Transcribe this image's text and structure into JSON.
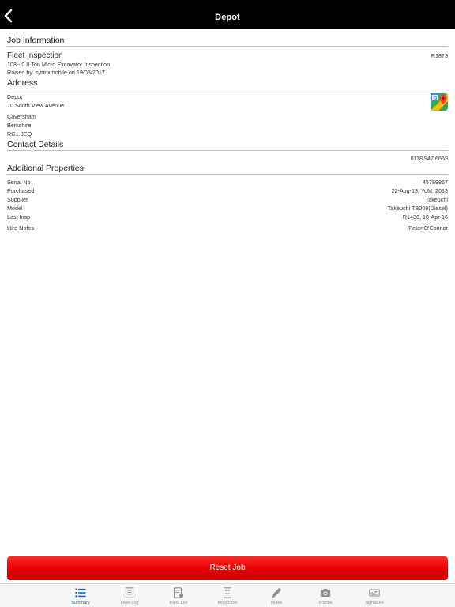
{
  "nav": {
    "title": "Depot"
  },
  "job_info": {
    "heading": "Job Information",
    "title": "Fleet Inspection",
    "ref": "R1873",
    "description": "108 - 0.8 Ton Micro Excavator Inspection",
    "raised_by": "Raised by: syrinxmobile on 19/05/2017"
  },
  "address": {
    "heading": "Address",
    "lines": [
      "Depot",
      "70 South View Avenue",
      "Caversham",
      "Berkshire",
      "RG1 8EQ"
    ]
  },
  "contact": {
    "heading": "Contact Details",
    "phone": "0118 947 6669"
  },
  "properties": {
    "heading": "Additional Properties",
    "rows": [
      {
        "label": "Serial No",
        "value": "45789867"
      },
      {
        "label": "Purchased",
        "value": "22-Aug-13, YoM: 2013"
      },
      {
        "label": "Supplier",
        "value": "Takeuchi"
      },
      {
        "label": "Model",
        "value": "Takeuchi TB008(Diesel)"
      },
      {
        "label": "Last Insp",
        "value": "R1436, 18-Apr-16"
      },
      {
        "label": "Hire Notes",
        "value": "Peter O'Connor"
      }
    ]
  },
  "reset_label": "Reset Job",
  "tabs": [
    {
      "label": "Summary",
      "icon": "list-icon"
    },
    {
      "label": "Fleet Log",
      "icon": "log-icon"
    },
    {
      "label": "Parts List",
      "icon": "parts-icon"
    },
    {
      "label": "Inspection",
      "icon": "inspection-icon"
    },
    {
      "label": "Notes",
      "icon": "pencil-icon"
    },
    {
      "label": "Photos",
      "icon": "camera-icon"
    },
    {
      "label": "Signature",
      "icon": "signature-icon"
    }
  ],
  "colors": {
    "accent": "#1a6ad8",
    "button": "#e40000",
    "nav": "#000000"
  }
}
